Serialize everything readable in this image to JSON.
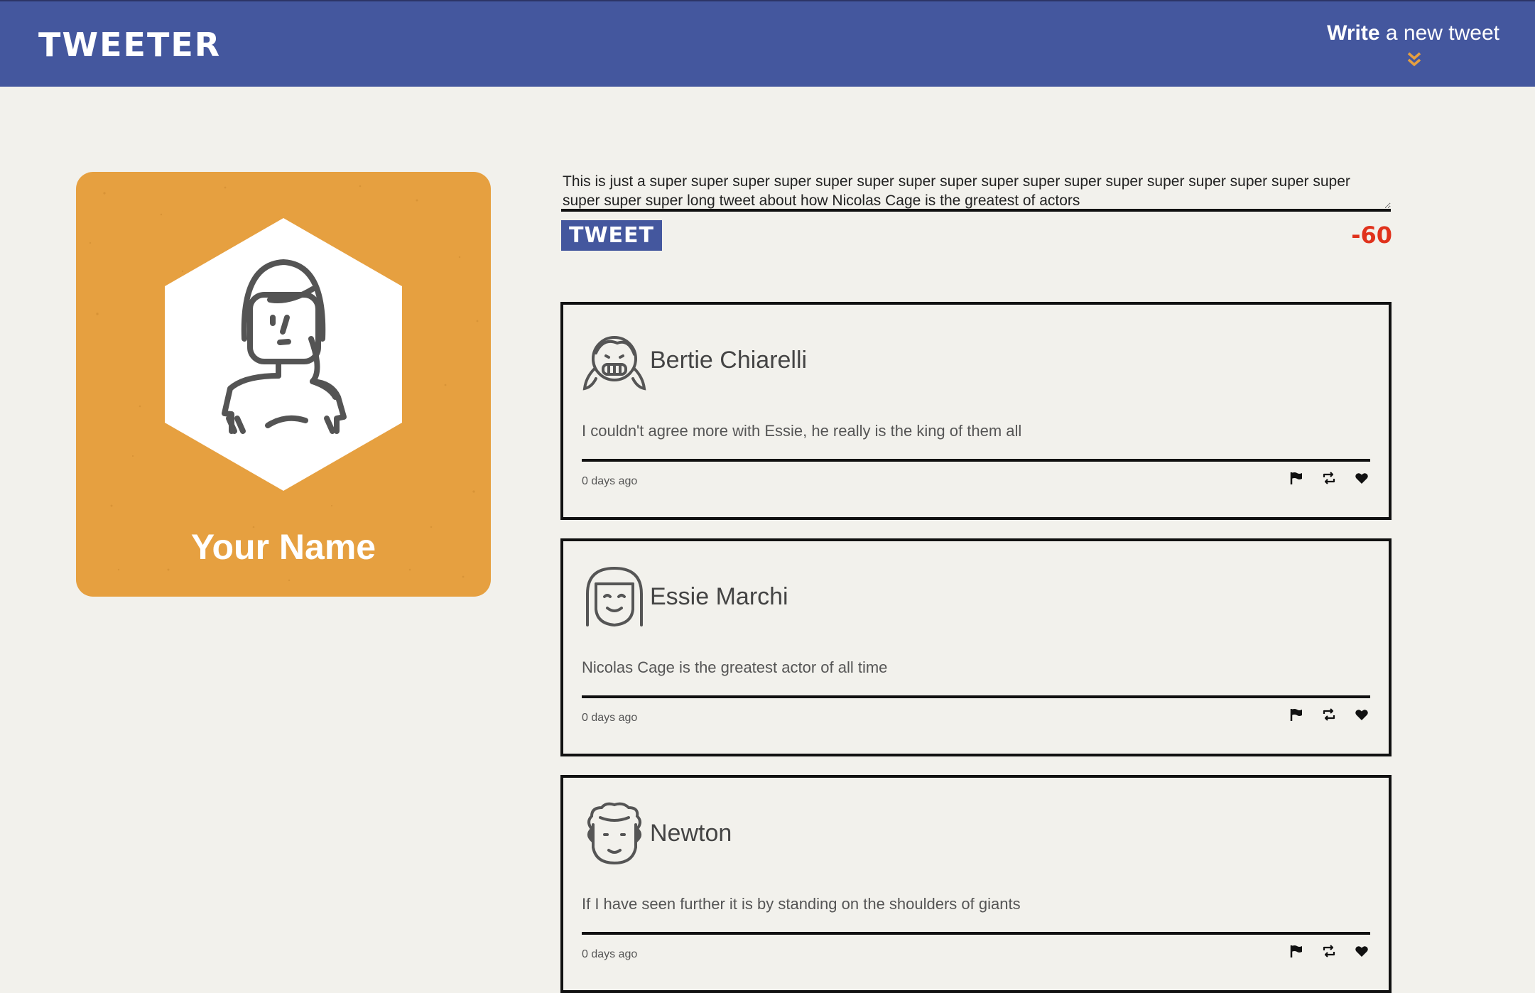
{
  "nav": {
    "logo": "TWEETER",
    "compose_bold": "Write",
    "compose_rest": " a new tweet",
    "compose_icon": "double-chevron-down-icon"
  },
  "profile": {
    "name": "Your Name",
    "avatar_icon": "girl-avatar-icon",
    "card_color": "#e6a040"
  },
  "compose": {
    "text": "This is just a super super super super super super super super super super super super super super super super super super super super long tweet about how Nicolas Cage is the greatest of actors",
    "button_label": "TWEET",
    "counter": "-60"
  },
  "tweets": [
    {
      "author": "Bertie Chiarelli",
      "avatar_icon": "grinning-girl-avatar-icon",
      "content": "I couldn't agree more with Essie, he really is the king of them all",
      "timestamp": "0 days ago"
    },
    {
      "author": "Essie Marchi",
      "avatar_icon": "smiling-girl-avatar-icon",
      "content": "Nicolas Cage is the greatest actor of all time",
      "timestamp": "0 days ago"
    },
    {
      "author": "Newton",
      "avatar_icon": "curly-hair-man-avatar-icon",
      "content": "If I have seen further it is by standing on the shoulders of giants",
      "timestamp": "0 days ago"
    }
  ],
  "colors": {
    "nav": "#44579e",
    "background": "#f2f1ec",
    "accent_orange": "#e6a040",
    "counter_red": "#e0321c"
  }
}
